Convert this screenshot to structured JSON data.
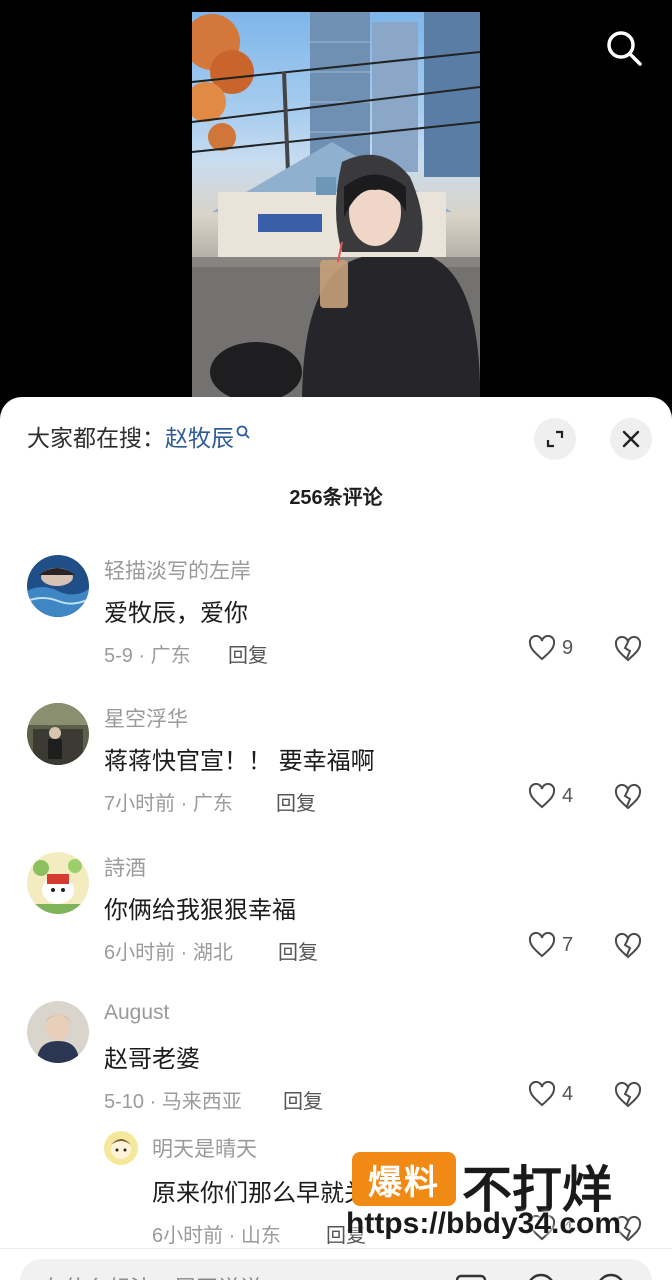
{
  "header": {
    "trend_label": "大家都在搜：",
    "trend_keyword": "赵牧辰"
  },
  "comment_count": "256条评论",
  "comments": [
    {
      "username": "轻描淡写的左岸",
      "content": "爱牧辰，爱你",
      "meta": "5-9 · 广东",
      "reply": "回复",
      "likes": "9"
    },
    {
      "username": "星空浮华",
      "content": "蒋蒋快官宣！！ 要幸福啊",
      "meta": "7小时前 · 广东",
      "reply": "回复",
      "likes": "4"
    },
    {
      "username": "詩酒",
      "content": "你俩给我狠狠幸福",
      "meta": "6小时前 · 湖北",
      "reply": "回复",
      "likes": "7"
    },
    {
      "username": "August",
      "content": "赵哥老婆",
      "meta": "5-10 · 马来西亚",
      "reply": "回复",
      "likes": "4"
    }
  ],
  "sub_reply": {
    "username": "明天是晴天",
    "content": "原来你们那么早就关注啦",
    "meta": "6小时前 · 山东",
    "reply": "回复",
    "likes": "4"
  },
  "watermark": {
    "box_text": "爆料",
    "text": "不打烊",
    "url": "https://bbdy34.com"
  },
  "input": {
    "placeholder": "有什么想法，展开说说"
  },
  "colors": {
    "accent_link": "#2f5d98",
    "watermark_orange": "#f08a14"
  },
  "icons": [
    "search-icon",
    "expand-icon",
    "close-icon",
    "heart-icon",
    "broken-heart-icon",
    "image-icon",
    "at-icon",
    "emoji-icon"
  ]
}
